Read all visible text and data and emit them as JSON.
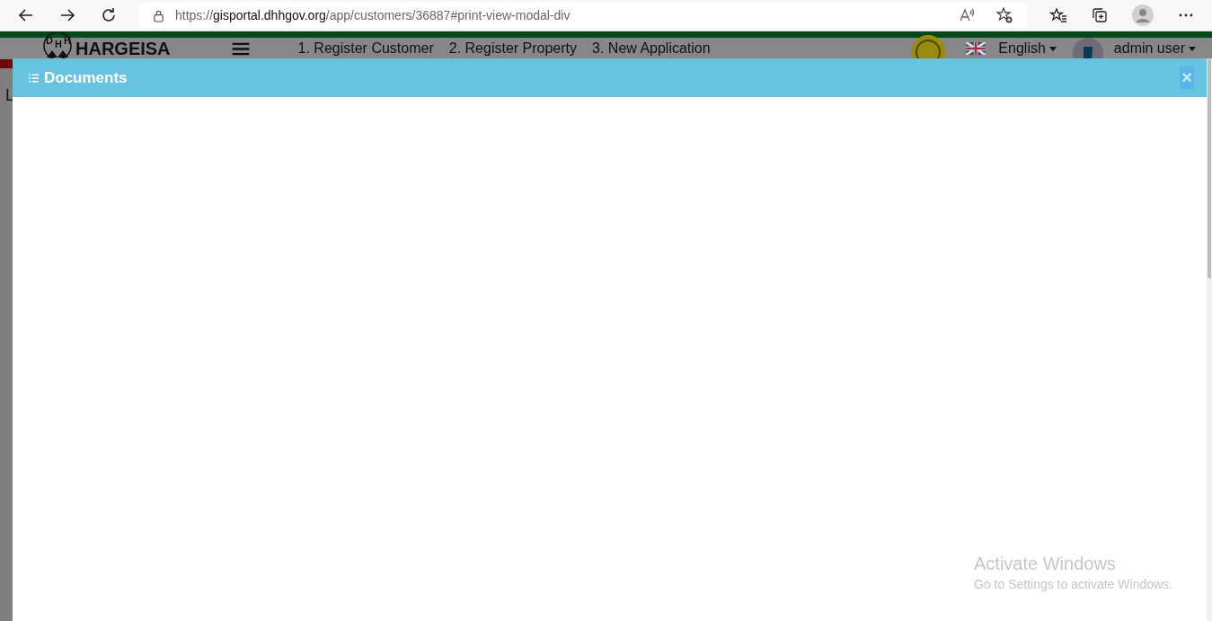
{
  "browser": {
    "url_scheme": "https://",
    "url_host": "gisportal.dhhgov.org",
    "url_path": "/app/customers/36887#print-view-modal-div"
  },
  "navbar": {
    "brand": "HARGEISA",
    "logo_letters": [
      "D",
      "H",
      "H"
    ],
    "links": [
      "1. Register Customer",
      "2. Register Property",
      "3. New Application"
    ],
    "language": "English",
    "user": "admin user"
  },
  "page": {
    "breadcrumb": "L"
  },
  "modal": {
    "title": "Documents",
    "close": "×"
  },
  "os_notice": {
    "title": "Activate Windows",
    "text": "Go to Settings to activate Windows."
  }
}
